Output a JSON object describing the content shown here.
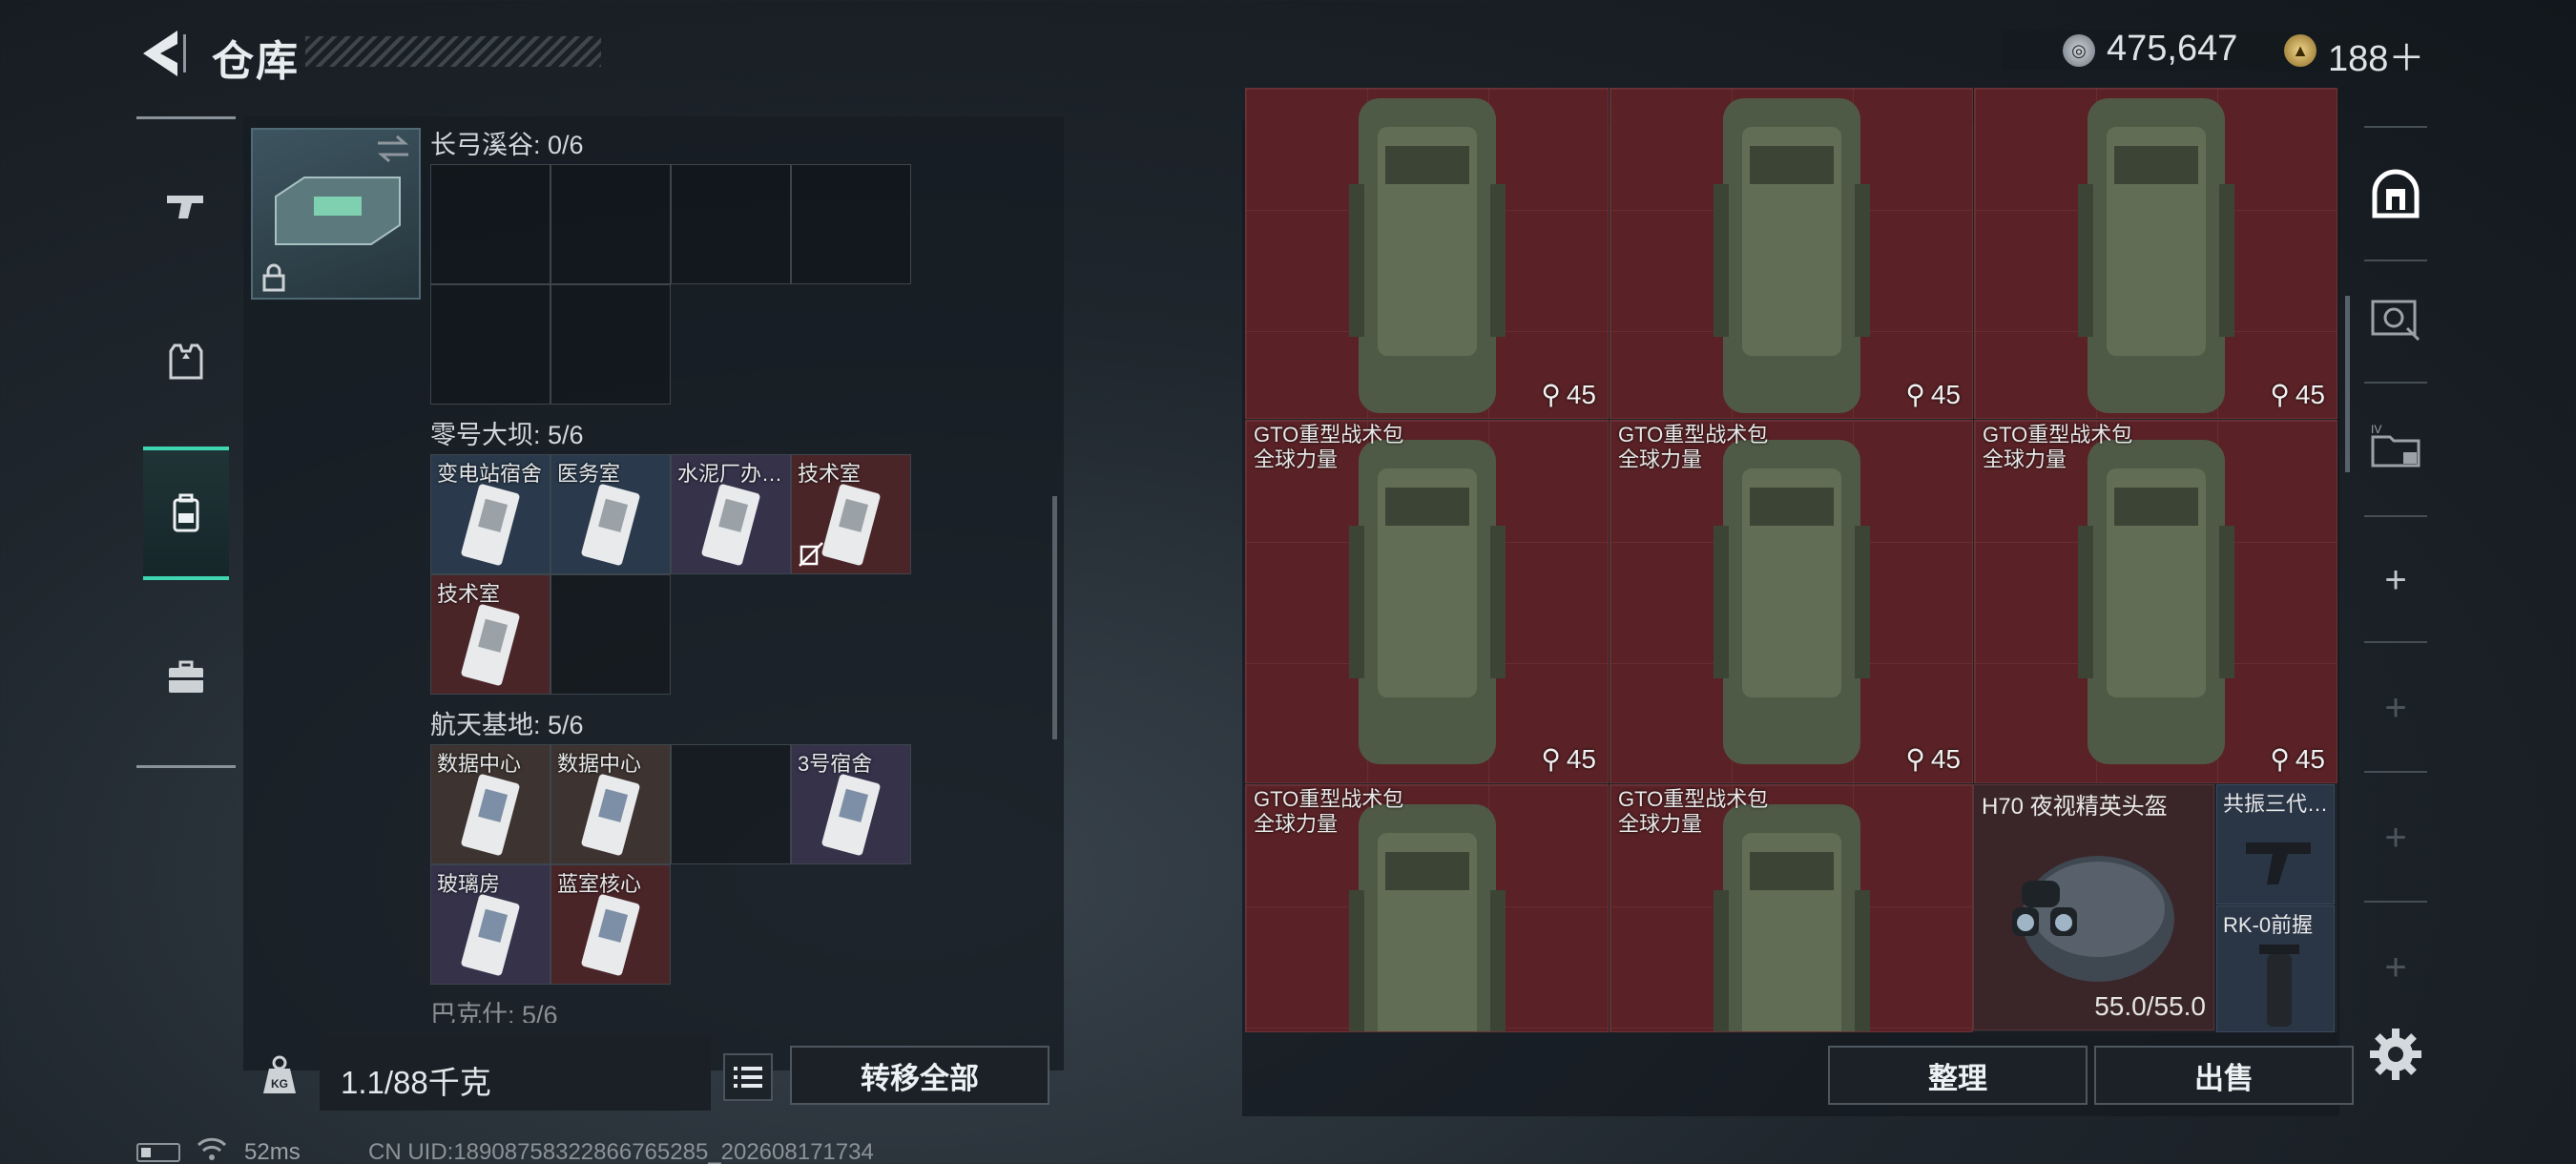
{
  "header": {
    "title": "仓库",
    "currency1": "475,647",
    "currency2": "188＋"
  },
  "left_panel": {
    "sections": [
      {
        "title": "长弓溪谷: 0/6"
      },
      {
        "title": "零号大坝: 5/6",
        "cards": [
          "变电站宿舍",
          "医务室",
          "水泥厂办…",
          "技术室",
          "技术室"
        ]
      },
      {
        "title": "航天基地: 5/6",
        "cards": [
          "数据中心",
          "数据中心",
          "3号宿舍",
          "玻璃房",
          "蓝室核心"
        ]
      },
      {
        "title": "巴克什: 5/6"
      }
    ],
    "weight": "1.1/88千克",
    "transfer_all_label": "转移全部"
  },
  "right_panel": {
    "backpack_name_line1": "GTO重型战术包",
    "backpack_name_line2": "全球力量",
    "backpack_capacity": "45",
    "helmet_name": "H70 夜视精英头盔",
    "helmet_durability": "55.0/55.0",
    "small_item1": "共振三代…",
    "small_item2": "RK-0前握",
    "sort_label": "整理",
    "sell_label": "出售"
  },
  "side_nav": {
    "plus": "+"
  },
  "status": {
    "ping": "52ms",
    "uid": "CN UID:1890875832286676528​5_202608171734"
  },
  "icons": [
    "back-icon",
    "silver-coin-icon",
    "gold-coin-icon",
    "pistol-icon",
    "armor-icon",
    "backpack-icon",
    "case-icon",
    "swap-icon",
    "lock-icon",
    "weight-icon",
    "list-icon",
    "safe-icon",
    "vault-icon",
    "folder-icon",
    "gear-icon",
    "battery-icon",
    "wifi-icon"
  ],
  "colors": {
    "accent": "#3fd6b2",
    "item_red": "#5a2226",
    "item_blue": "#2a3a4c",
    "item_purple": "#35324a"
  }
}
